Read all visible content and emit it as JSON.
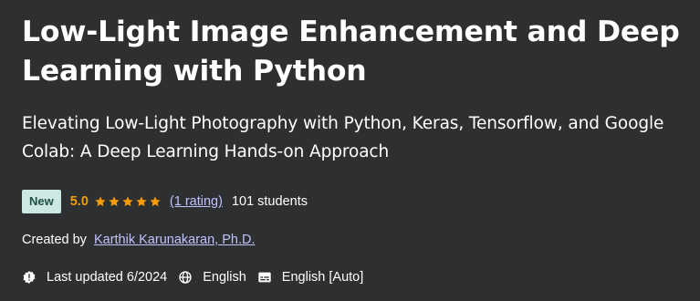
{
  "course": {
    "title": "Low-Light Image Enhancement and Deep Learning with Python",
    "subtitle_lines": [
      "Elevating Low-Light Photography with Python, Keras, Tensorflow, and Google",
      "Colab: A Deep Learning Hands-on Approach"
    ]
  },
  "rating": {
    "badge": "New",
    "value": "5.0",
    "stars": 5,
    "count_link": "(1 rating)",
    "students": "101 students"
  },
  "created": {
    "prefix": "Created by",
    "author": "Karthik Karunakaran, Ph.D."
  },
  "meta": {
    "updated": "Last updated 6/2024",
    "language": "English",
    "captions": "English [Auto]",
    "icons": [
      "alert-badge-icon",
      "globe-icon",
      "closed-caption-icon"
    ]
  },
  "colors": {
    "background": "#2d2f31",
    "badge_bg": "#cde8e4",
    "badge_text": "#1d4f44",
    "rating": "#f69c08",
    "link": "#c0c4fc"
  }
}
